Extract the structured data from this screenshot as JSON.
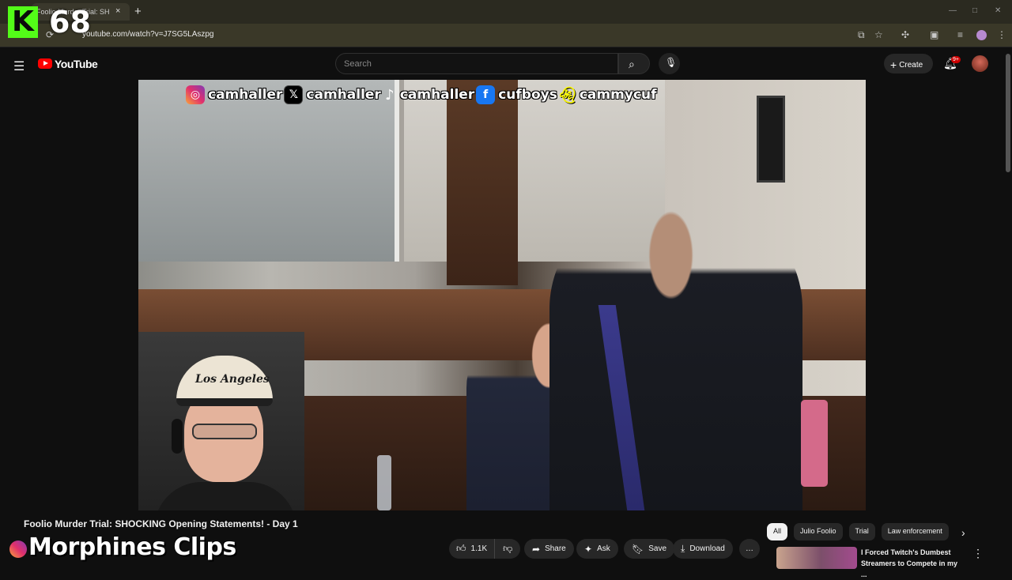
{
  "browser": {
    "tab_title": "Foolio Murder Trial: SH",
    "close_tab": "×",
    "new_tab": "+",
    "url": "youtube.com/watch?v=J7SG5LAszpg",
    "reload_icon": "reload-icon",
    "window_controls": [
      "—",
      "□",
      "✕"
    ]
  },
  "overlay": {
    "kick_logo": "K",
    "viewer_count": "68"
  },
  "youtube": {
    "logo_text": "YouTube",
    "search_placeholder": "Search",
    "create_label": "Create",
    "notification_badge": "9+",
    "accent_color": "#ff0000"
  },
  "video": {
    "socials": [
      {
        "platform": "instagram",
        "handle": "camhaller"
      },
      {
        "platform": "x",
        "handle": "camhaller"
      },
      {
        "platform": "tiktok",
        "handle": "camhaller"
      },
      {
        "platform": "facebook",
        "handle": "cufboys"
      },
      {
        "platform": "snapchat",
        "handle": "cammycuf"
      }
    ],
    "cap_text": "Los Angeles"
  },
  "below": {
    "title": "Foolio Murder Trial: SHOCKING Opening Statements! - Day 1",
    "watermark": "Morphines Clips",
    "actions": {
      "likes": "1.1K",
      "share": "Share",
      "ask": "Ask",
      "save": "Save",
      "download": "Download",
      "more": "…"
    }
  },
  "sidebar": {
    "chips": [
      "All",
      "Julio Foolio",
      "Trial",
      "Law enforcement"
    ],
    "recommended_title": "I Forced Twitch's Dumbest Streamers to Compete in my ..."
  }
}
